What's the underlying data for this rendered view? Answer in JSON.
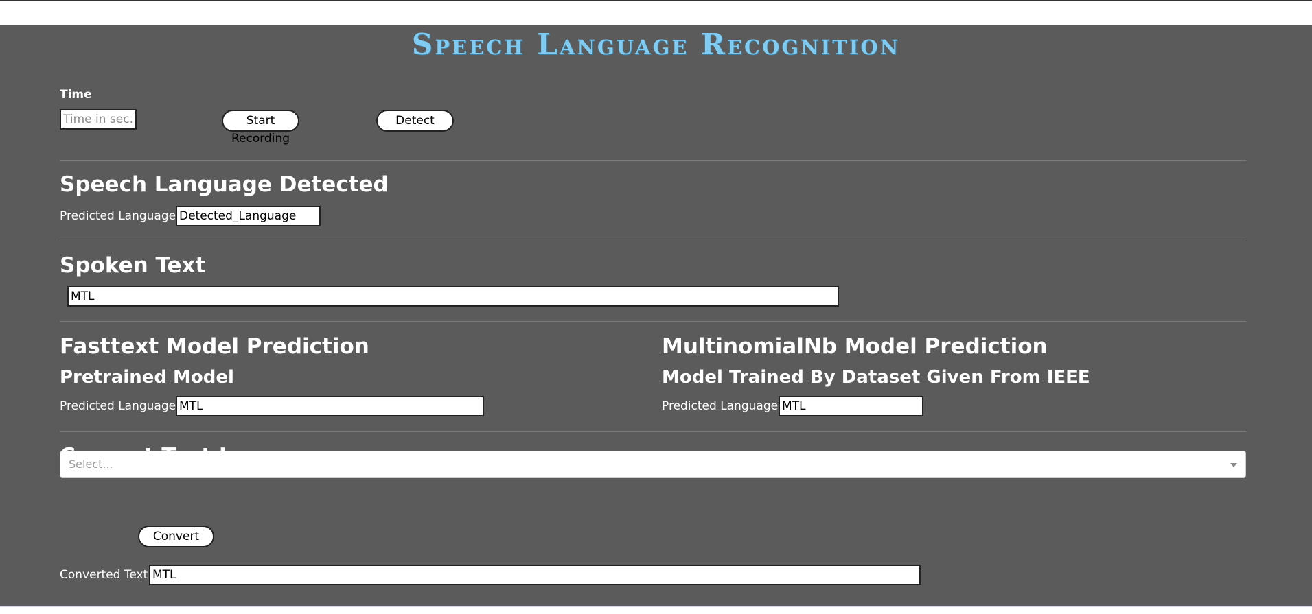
{
  "title": "Speech Language Recognition",
  "recording": {
    "time_label": "Time",
    "time_placeholder": "Time in sec..",
    "start_label": "Start",
    "start_sublabel": "Recording",
    "detect_label": "Detect"
  },
  "speech_detected": {
    "heading": "Speech Language Detected",
    "field_label": "Predicted Language",
    "field_value": "Detected_Language"
  },
  "spoken_text": {
    "heading": "Spoken Text",
    "value": "MTL"
  },
  "fasttext": {
    "heading": "Fasttext Model Prediction",
    "subheading": "Pretrained Model",
    "field_label": "Predicted Language",
    "field_value": "MTL"
  },
  "multinomialnb": {
    "heading": "MultinomialNb Model Prediction",
    "subheading": "Model Trained By Dataset Given From IEEE",
    "field_label": "Predicted Language",
    "field_value": "MTL"
  },
  "convert": {
    "heading": "Convert Text In",
    "select_placeholder": "Select...",
    "button_label": "Convert",
    "output_label": "Converted Text",
    "output_value": "MTL"
  },
  "colors": {
    "panel_bg": "#5b5b5b",
    "title_color": "#7fcbf1"
  }
}
